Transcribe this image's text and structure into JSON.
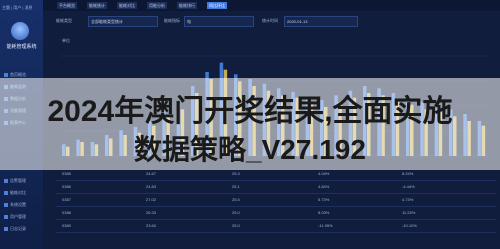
{
  "sidebar": {
    "top_label": "主题 | 用户 | 消息",
    "brand": "能耗管理系统",
    "items": [
      "首页概览",
      "能耗监测",
      "数据分析",
      "设备管理",
      "报表中心",
      "告警管理",
      "能耗对比",
      "系统设置",
      "用户管理",
      "日志记录"
    ]
  },
  "topbar": {
    "tabs": [
      "平台概览",
      "能耗统计",
      "能耗对比",
      "用能分析",
      "能耗排行",
      "同比环比"
    ]
  },
  "filters": {
    "label1": "能耗类型",
    "value1": "全部能耗类型统计",
    "label2": "能耗指标",
    "value2": "电",
    "label3": "统计时间",
    "value3": "2020-01-13"
  },
  "chart": {
    "title": "单位"
  },
  "chart_data": {
    "type": "bar",
    "categories": [
      "1",
      "2",
      "3",
      "4",
      "5",
      "6",
      "7",
      "8",
      "9",
      "10",
      "11",
      "12",
      "13",
      "14",
      "15",
      "16",
      "17",
      "18",
      "19",
      "20",
      "21",
      "22",
      "23",
      "24",
      "25",
      "26",
      "27",
      "28",
      "29",
      "30"
    ],
    "series": [
      {
        "values": [
          10,
          14,
          12,
          18,
          22,
          25,
          30,
          38,
          45,
          60,
          72,
          80,
          70,
          66,
          62,
          58,
          55,
          50,
          48,
          52,
          56,
          60,
          58,
          54,
          50,
          46,
          42,
          40,
          36,
          30
        ]
      },
      {
        "values": [
          8,
          12,
          10,
          15,
          18,
          20,
          26,
          34,
          40,
          54,
          66,
          74,
          64,
          60,
          56,
          52,
          50,
          44,
          42,
          46,
          50,
          54,
          52,
          48,
          44,
          40,
          38,
          34,
          30,
          26
        ]
      }
    ],
    "colors": [
      "#4a8af0",
      "#e6c75a"
    ]
  },
  "table": {
    "rows": [
      [
        "0385",
        "24.67",
        "25.3",
        "4.04%",
        "8.24%"
      ],
      [
        "0386",
        "24.83",
        "25.1",
        "4.84%",
        "-4.44%"
      ],
      [
        "0387",
        "27.02",
        "25.5",
        "5.73%",
        "4.73%"
      ],
      [
        "0388",
        "26.33",
        "25.0",
        "8.03%",
        "11.25%"
      ],
      [
        "0389",
        "23.60",
        "25.0",
        "-11.95%",
        "-10.10%"
      ]
    ]
  },
  "overlay": {
    "line1": "2024年澳门开奖结果,全面实施",
    "line2": "数据策略_V27.192"
  }
}
